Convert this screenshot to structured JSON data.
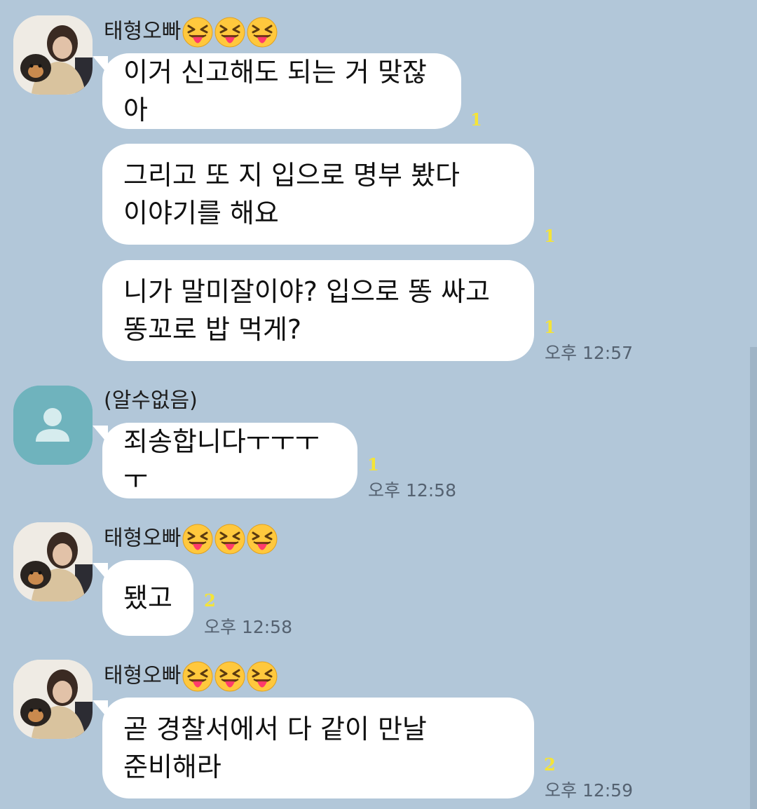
{
  "messages": [
    {
      "sender": "태형오빠",
      "emoji_icon": "squinting-face-with-tongue-icon",
      "bubbles": [
        {
          "lines": [
            "이거 신고해도 되는 거 맞잖아"
          ],
          "unread": "1"
        },
        {
          "lines": [
            "그리고 또 지 입으로 명부 봤다",
            "이야기를 해요"
          ],
          "unread": "1"
        },
        {
          "lines": [
            "니가 말미잘이야? 입으로 똥 싸고",
            "똥꼬로 밥 먹게?"
          ],
          "unread": "1",
          "time": "오후 12:57"
        }
      ]
    },
    {
      "sender": "(알수없음)",
      "bubbles": [
        {
          "lines": [
            "죄송합니다ㅜㅜㅜㅜ"
          ],
          "unread": "1",
          "time": "오후 12:58"
        }
      ]
    },
    {
      "sender": "태형오빠",
      "bubbles": [
        {
          "lines": [
            "됐고"
          ],
          "unread": "2",
          "time": "오후 12:58"
        }
      ]
    },
    {
      "sender": "태형오빠",
      "bubbles": [
        {
          "lines": [
            "곧 경찰서에서 다 같이 만날",
            "준비해라"
          ],
          "unread": "2",
          "time": "오후 12:59"
        }
      ]
    }
  ],
  "colors": {
    "background": "#b2c7d9",
    "bubble": "#ffffff",
    "unread": "#f5e437",
    "time": "#556271"
  }
}
